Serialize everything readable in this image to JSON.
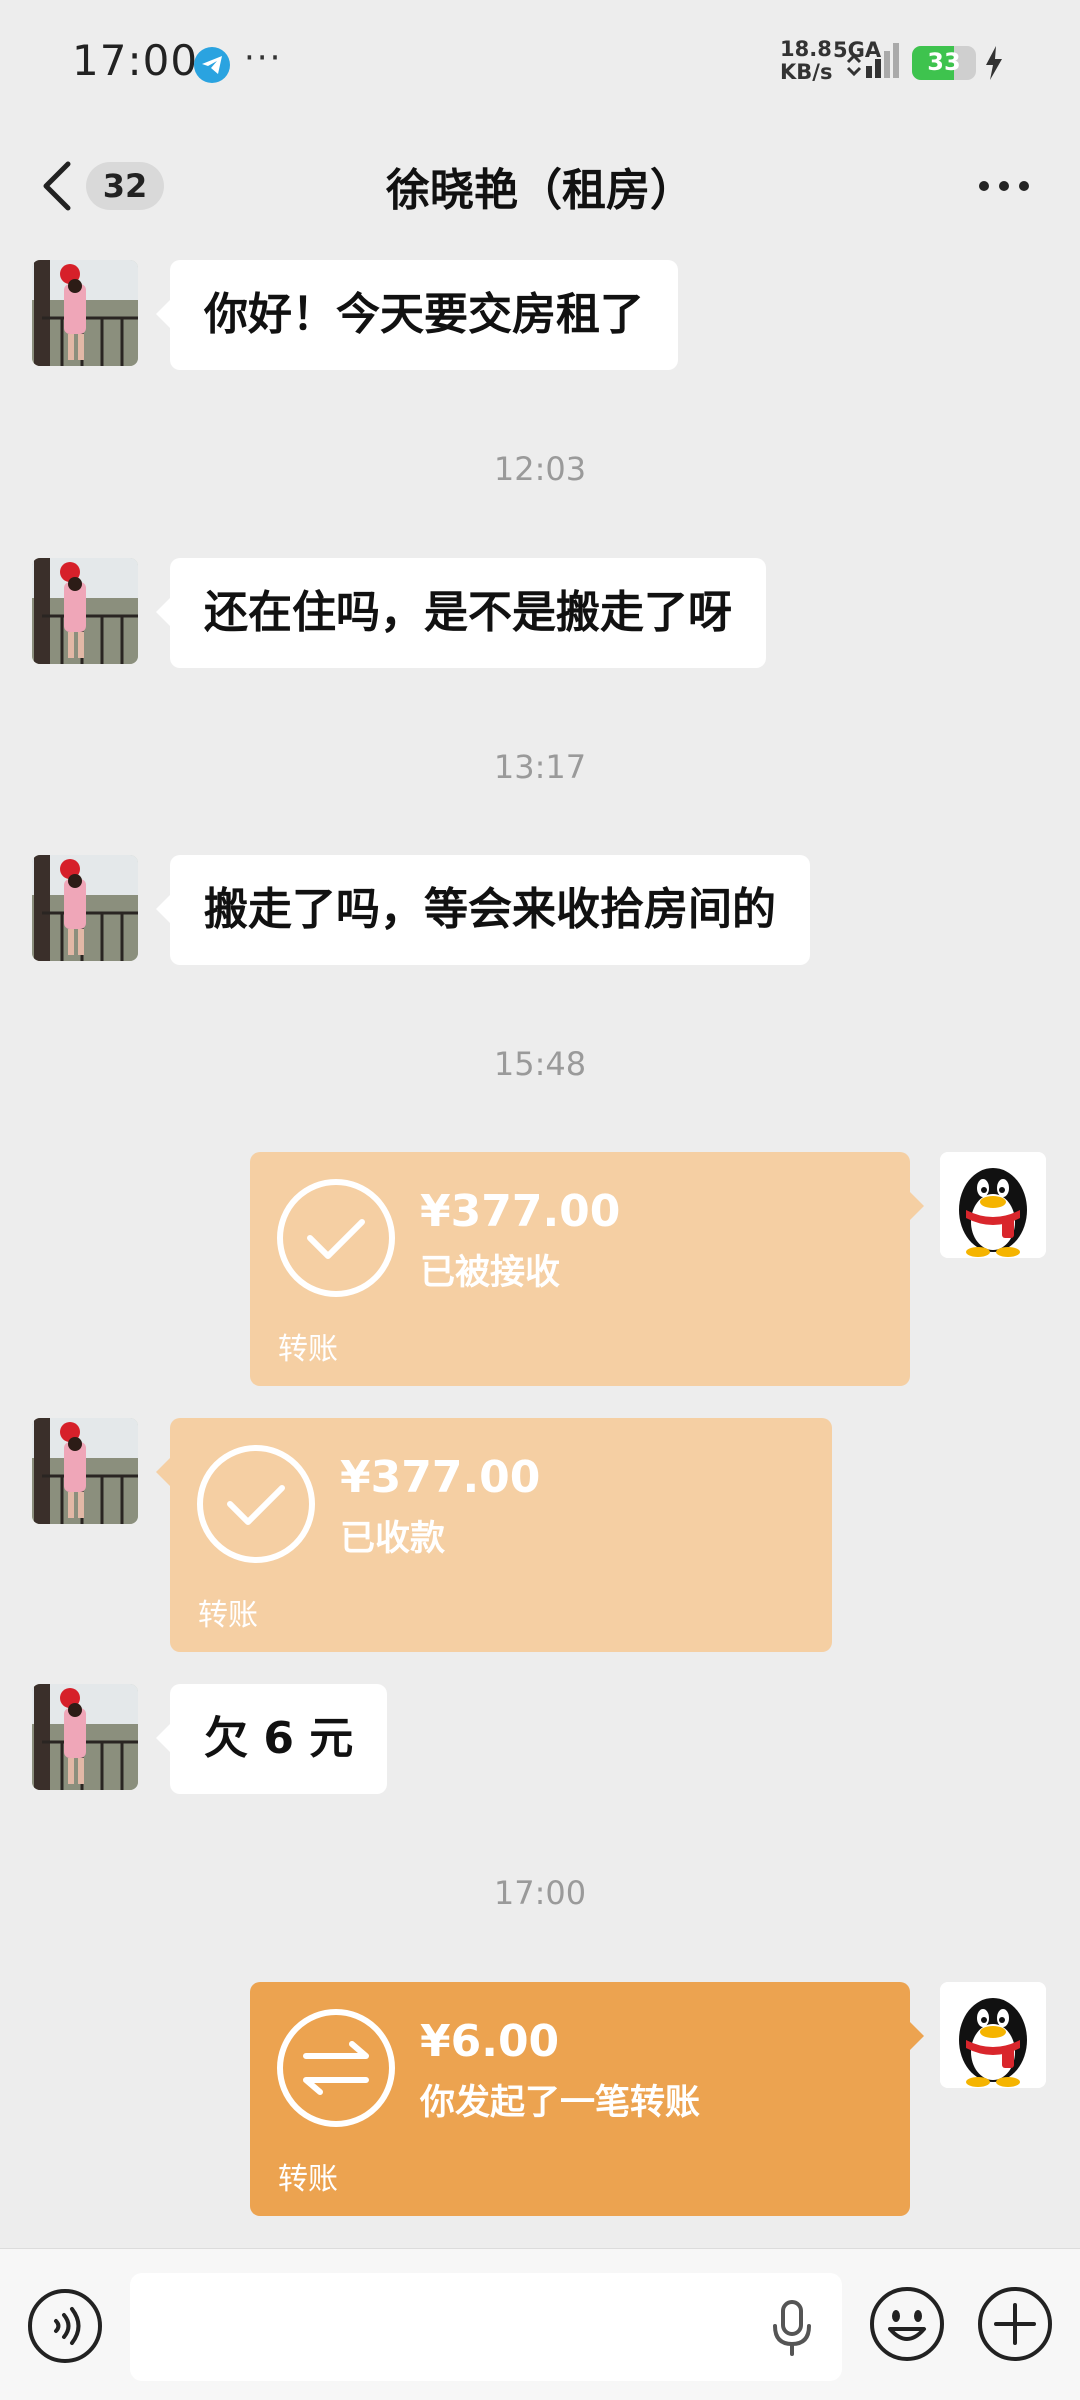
{
  "status_bar": {
    "time": "17:00",
    "more": "···",
    "net_speed": "18.8",
    "net_type": "5GA",
    "net_unit": "KB/s",
    "battery": "33",
    "icons": [
      "telegram-icon",
      "signal-icon",
      "battery-icon",
      "charging-icon"
    ]
  },
  "header": {
    "unread_count": "32",
    "title": "徐晓艳（租房）"
  },
  "messages": [
    {
      "type": "text",
      "from": "contact",
      "text": "你好！今天要交房租了"
    },
    {
      "type": "time",
      "text": "12:03"
    },
    {
      "type": "text",
      "from": "contact",
      "text": "还在住吗，是不是搬走了呀"
    },
    {
      "type": "time",
      "text": "13:17"
    },
    {
      "type": "text",
      "from": "contact",
      "text": "搬走了吗，等会来收拾房间的"
    },
    {
      "type": "time",
      "text": "15:48"
    },
    {
      "type": "transfer",
      "from": "me",
      "amount": "¥377.00",
      "status": "已被接收",
      "label": "转账",
      "icon": "check-icon"
    },
    {
      "type": "transfer",
      "from": "contact",
      "amount": "¥377.00",
      "status": "已收款",
      "label": "转账",
      "icon": "check-icon"
    },
    {
      "type": "text",
      "from": "contact",
      "text": "欠 6 元"
    },
    {
      "type": "time",
      "text": "17:00"
    },
    {
      "type": "transfer",
      "from": "me",
      "amount": "¥6.00",
      "status": "你发起了一笔转账",
      "label": "转账",
      "icon": "transfer-arrows-icon"
    }
  ],
  "colors": {
    "background": "#ededed",
    "bubble": "#ffffff",
    "transfer_done": "#f5cfa3",
    "transfer_pending": "#eca350",
    "timestamp": "#9a9a9a",
    "battery": "#3ec34e"
  },
  "input_bar": {
    "value": "",
    "icons": [
      "voice-icon",
      "mic-icon",
      "emoji-icon",
      "plus-icon"
    ]
  }
}
